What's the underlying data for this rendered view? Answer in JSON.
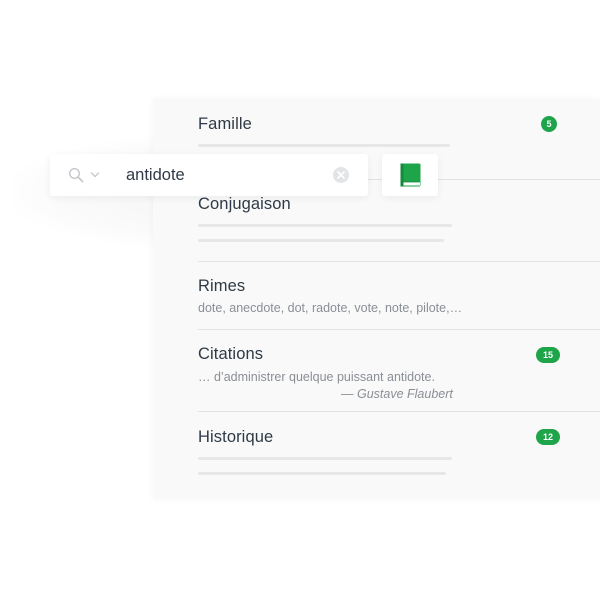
{
  "search": {
    "query": "antidote"
  },
  "sections": {
    "famille": {
      "title": "Famille",
      "count": "5"
    },
    "conjugaison": {
      "title": "Conjugaison"
    },
    "rimes": {
      "title": "Rimes",
      "preview": "dote, anecdote, dot, radote, vote, note, pilote,…"
    },
    "citations": {
      "title": "Citations",
      "count": "15",
      "quote": "… d’administrer quelque puissant antidote.",
      "author": "— Gustave Flaubert"
    },
    "historique": {
      "title": "Historique",
      "count": "12"
    }
  },
  "colors": {
    "accent": "#1ea54a",
    "text": "#2f3a46",
    "muted": "#8a8f96"
  },
  "icons": [
    "search-icon",
    "chevron-down-icon",
    "clear-icon",
    "book-icon"
  ]
}
